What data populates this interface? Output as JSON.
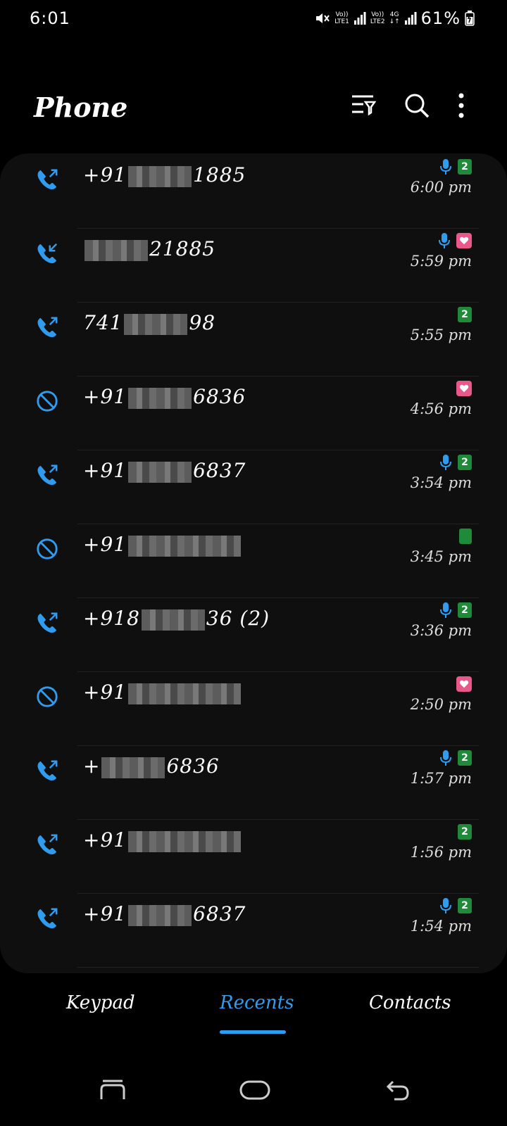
{
  "status_bar": {
    "time": "6:01",
    "sim1_label_top": "Vo))",
    "sim1_label_bottom": "LTE1",
    "sim2_label_top": "Vo))",
    "sim2_label_bottom": "LTE2",
    "network_type": "4G",
    "battery": "61%"
  },
  "header": {
    "title": "Phone",
    "filter_icon": "filter-icon",
    "search_icon": "search-icon",
    "more_icon": "more-vertical-icon"
  },
  "calls": [
    {
      "type": "outgoing",
      "number_prefix": "+91",
      "number_suffix": "1885",
      "mic": true,
      "sim": "2",
      "time": "6:00 pm"
    },
    {
      "type": "incoming",
      "number_prefix": "",
      "number_suffix": "21885",
      "mic": true,
      "sim": "heart",
      "time": "5:59 pm"
    },
    {
      "type": "outgoing",
      "number_prefix": "741",
      "number_suffix": "98",
      "mic": false,
      "sim": "2",
      "time": "5:55 pm"
    },
    {
      "type": "blocked",
      "number_prefix": "+91",
      "number_suffix": "6836",
      "mic": false,
      "sim": "heart",
      "time": "4:56 pm"
    },
    {
      "type": "outgoing",
      "number_prefix": "+91",
      "number_suffix": "6837",
      "mic": true,
      "sim": "2",
      "time": "3:54 pm"
    },
    {
      "type": "blocked",
      "number_prefix": "+91",
      "number_suffix": "",
      "mic": false,
      "sim": "plain",
      "time": "3:45 pm"
    },
    {
      "type": "outgoing",
      "number_prefix": "+918",
      "number_suffix": "36 (2)",
      "mic": true,
      "sim": "2",
      "time": "3:36 pm"
    },
    {
      "type": "blocked",
      "number_prefix": "+91",
      "number_suffix": "",
      "mic": false,
      "sim": "heart",
      "time": "2:50 pm"
    },
    {
      "type": "outgoing",
      "number_prefix": "+",
      "number_suffix": "6836",
      "mic": true,
      "sim": "2",
      "time": "1:57 pm"
    },
    {
      "type": "outgoing",
      "number_prefix": "+91",
      "number_suffix": "",
      "mic": false,
      "sim": "2",
      "time": "1:56 pm"
    },
    {
      "type": "outgoing",
      "number_prefix": "+91",
      "number_suffix": "6837",
      "mic": true,
      "sim": "2",
      "time": "1:54 pm"
    }
  ],
  "tabs": [
    {
      "label": "Keypad",
      "active": false
    },
    {
      "label": "Recents",
      "active": true
    },
    {
      "label": "Contacts",
      "active": false
    }
  ],
  "colors": {
    "accent": "#2f9cf0",
    "sim_green": "#1f8a3a",
    "heart_pink": "#e9588a",
    "card_bg": "#0f0f0f"
  }
}
